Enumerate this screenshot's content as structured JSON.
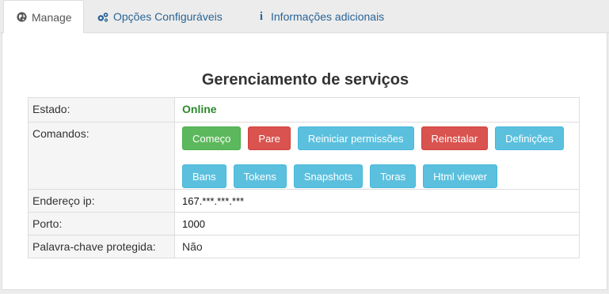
{
  "tabs": [
    {
      "label": "Manage",
      "icon": "globe-icon",
      "active": true
    },
    {
      "label": "Opções Configuráveis",
      "icon": "cogs-icon",
      "active": false
    },
    {
      "label": "Informações adicionais",
      "icon": "info-icon",
      "active": false
    }
  ],
  "main": {
    "title": "Gerenciamento de serviços",
    "rows": {
      "estado": {
        "label": "Estado:",
        "value": "Online"
      },
      "comandos": {
        "label": "Comandos:"
      },
      "ip": {
        "label": "Endereço ip:",
        "value": "167.***.***.***"
      },
      "porto": {
        "label": "Porto:",
        "value": "1000"
      },
      "senha": {
        "label": "Palavra-chave protegida:",
        "value": "Não"
      }
    },
    "buttons_row1": [
      {
        "label": "Começo",
        "color": "#5cb85c"
      },
      {
        "label": "Pare",
        "color": "#d9534f"
      },
      {
        "label": "Reiniciar permissões",
        "color": "#5bc0de"
      },
      {
        "label": "Reinstalar",
        "color": "#d9534f"
      },
      {
        "label": "Definições",
        "color": "#5bc0de"
      }
    ],
    "buttons_row2": [
      {
        "label": "Bans",
        "color": "#5bc0de"
      },
      {
        "label": "Tokens",
        "color": "#5bc0de"
      },
      {
        "label": "Snapshots",
        "color": "#5bc0de"
      },
      {
        "label": "Toras",
        "color": "#5bc0de"
      },
      {
        "label": "Html viewer",
        "color": "#5bc0de"
      }
    ]
  },
  "colors": {
    "link": "#2a6496",
    "online": "#2d8a2d",
    "success": "#5cb85c",
    "danger": "#d9534f",
    "info": "#5bc0de"
  }
}
